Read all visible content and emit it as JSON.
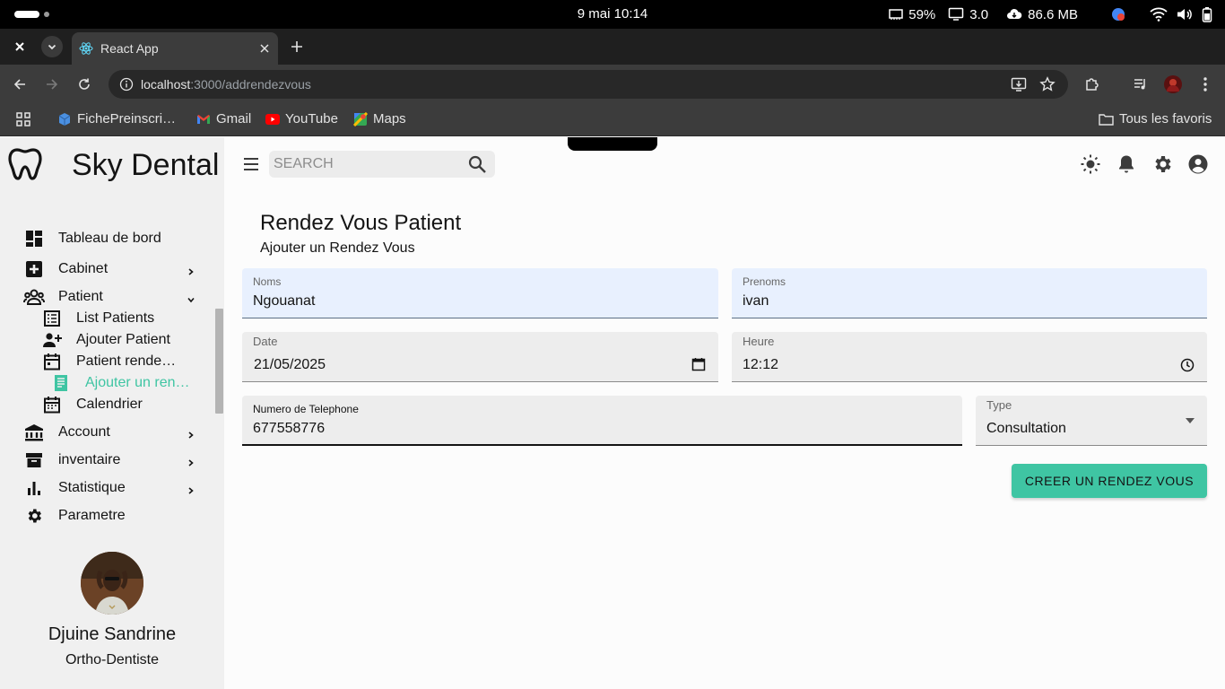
{
  "os": {
    "clock": "9 mai  10:14",
    "battery": "59%",
    "load": "3.0",
    "memory": "86.6 MB"
  },
  "browser": {
    "tab_title": "React App",
    "url_host": "localhost",
    "url_path": ":3000/addrendezvous",
    "bookmarks": [
      {
        "label": "FichePreinscri…",
        "icon": "box-icon"
      },
      {
        "label": "Gmail",
        "icon": "gmail-icon"
      },
      {
        "label": "YouTube",
        "icon": "youtube-icon"
      },
      {
        "label": "Maps",
        "icon": "maps-icon"
      }
    ],
    "all_bookmarks": "Tous les favoris"
  },
  "app": {
    "brand": "Sky Dental",
    "search_placeholder": "SEARCH",
    "accent_color": "#3fc5a3",
    "nav": {
      "dashboard": "Tableau de bord",
      "cabinet": "Cabinet",
      "patient": "Patient",
      "list_patients": "List Patients",
      "add_patient": "Ajouter Patient",
      "patient_rdv": "Patient rende…",
      "add_rdv": "Ajouter un ren…",
      "calendar": "Calendrier",
      "account": "Account",
      "inventory": "inventaire",
      "stats": "Statistique",
      "settings": "Parametre"
    },
    "user": {
      "name": "Djuine Sandrine",
      "role": "Ortho-Dentiste"
    }
  },
  "page": {
    "title": "Rendez Vous Patient",
    "subtitle": "Ajouter un Rendez Vous",
    "form": {
      "noms_label": "Noms",
      "noms_value": "Ngouanat",
      "prenoms_label": "Prenoms",
      "prenoms_value": "ivan",
      "date_label": "Date",
      "date_value": "21/05/2025",
      "heure_label": "Heure",
      "heure_value": "12:12",
      "phone_label": "Numero de Telephone",
      "phone_value": "677558776",
      "type_label": "Type",
      "type_value": "Consultation"
    },
    "submit_label": "CREER UN RENDEZ VOUS"
  }
}
